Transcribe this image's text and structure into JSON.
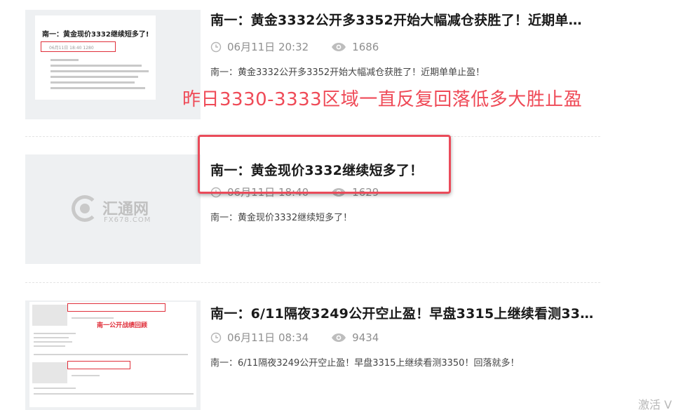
{
  "articles": [
    {
      "title": "南一：黄金3332公开多3352开始大幅减仓获胜了！近期单…",
      "date": "06月11日 20:32",
      "views": "1686",
      "summary": "南一：黄金3332公开多3352开始大幅减仓获胜了！近期单单止盈！",
      "thumb": {
        "title": "南一：黄金现价3332继续短多了!",
        "meta": "06月11日 18:40   1280"
      }
    },
    {
      "title": "南一：黄金现价3332继续短多了！",
      "date": "06月11日 18:40",
      "views": "1629",
      "summary": "南一：黄金现价3332继续短多了！",
      "thumb": {
        "logo_name": "汇通网",
        "logo_url": "FX678.COM"
      }
    },
    {
      "title": "南一：6/11隔夜3249公开空止盈！早盘3315上继续看测33…",
      "date": "06月11日 08:34",
      "views": "9434",
      "summary": "南一：6/11隔夜3249公开空止盈！早盘3315上继续看测3350！回落就多！",
      "thumb": {
        "banner": "南一公开战绩回顾"
      }
    }
  ],
  "icons": {
    "time": "clock-icon",
    "views": "eye-icon"
  },
  "annotation": {
    "text": "昨日3330-3333区域一直反复回落低多大胜止盈",
    "color": "#ef4a57"
  },
  "watermark": "激活 V"
}
